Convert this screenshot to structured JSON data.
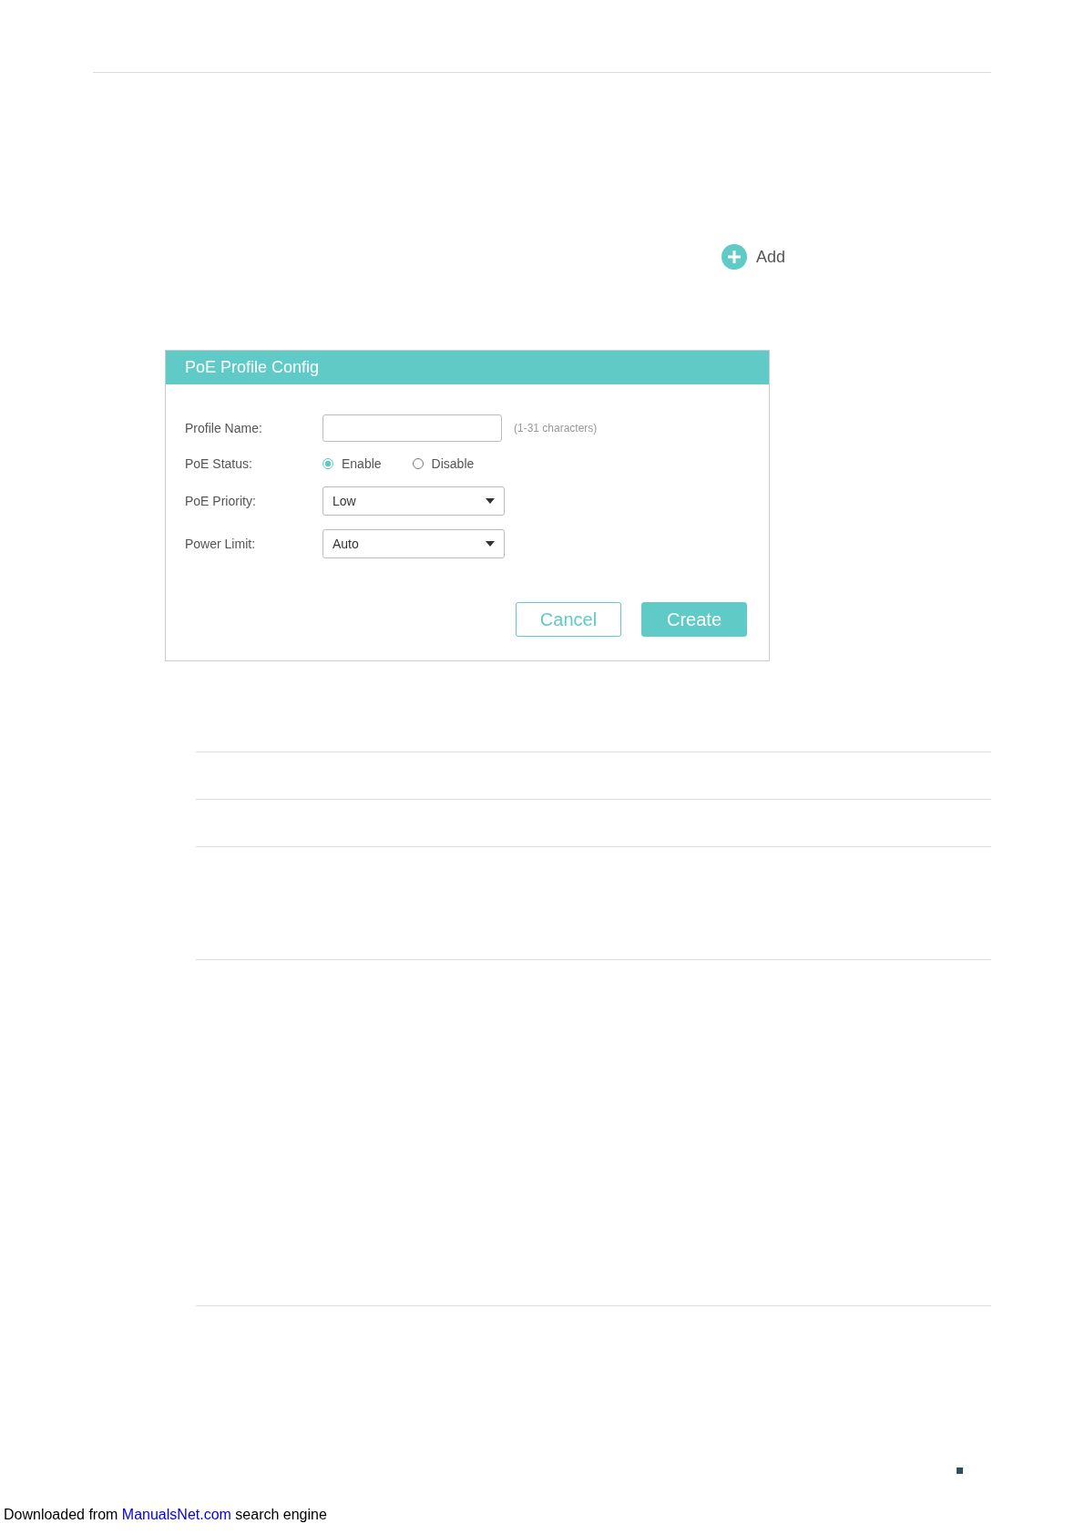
{
  "add_button": {
    "label": "Add"
  },
  "dialog": {
    "title": "PoE Profile Config",
    "fields": [
      {
        "kind": "text",
        "label": "Profile Name:",
        "hint": "(1-31 characters)"
      },
      {
        "kind": "radio",
        "label": "PoE Status:",
        "options": [
          {
            "label": "Enable",
            "selected": true
          },
          {
            "label": "Disable",
            "selected": false
          }
        ]
      },
      {
        "kind": "select",
        "label": "PoE Priority:",
        "value": "Low"
      },
      {
        "kind": "select",
        "label": "Power Limit:",
        "value": "Auto"
      }
    ],
    "buttons": [
      {
        "kind": "secondary",
        "label": "Cancel"
      },
      {
        "kind": "primary",
        "label": "Create"
      }
    ]
  },
  "footer": {
    "before": "Downloaded from ",
    "link": "ManualsNet.com",
    "after": " search engine"
  }
}
